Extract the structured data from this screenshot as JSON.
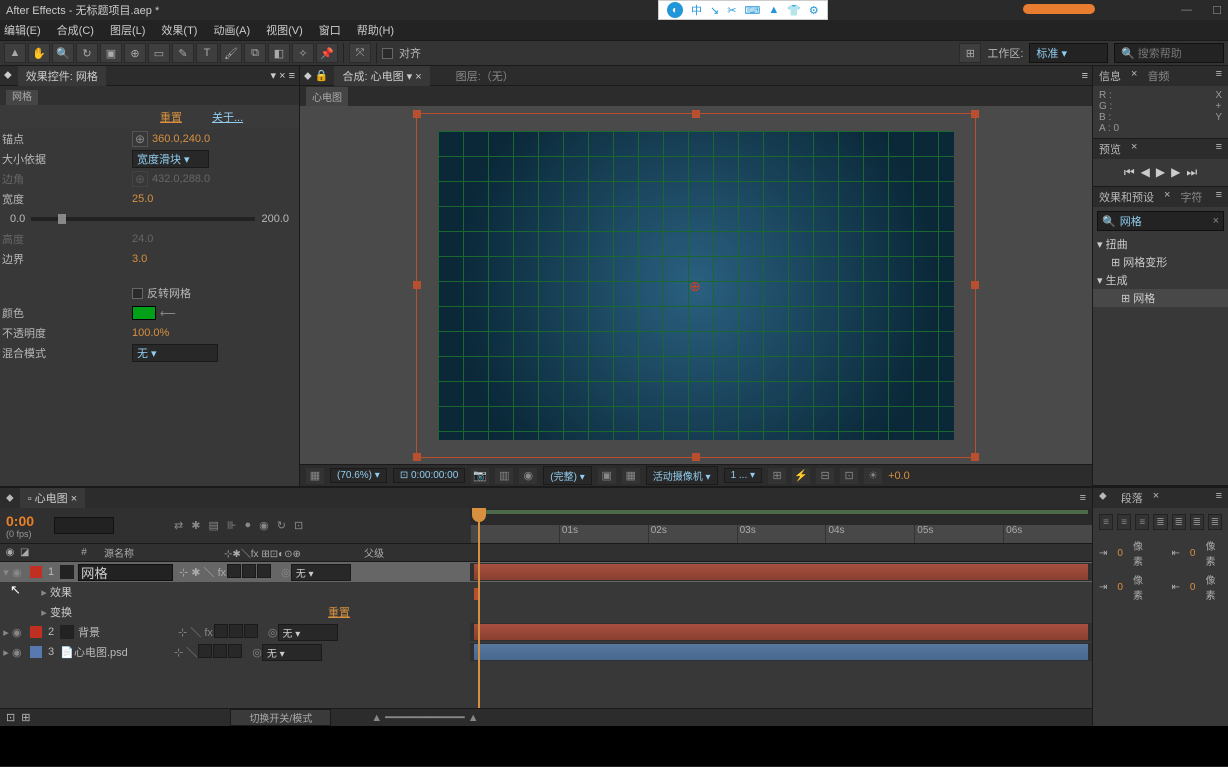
{
  "titlebar": {
    "title": "After Effects - 无标题项目.aep *"
  },
  "menubar": [
    "编辑(E)",
    "合成(C)",
    "图层(L)",
    "效果(T)",
    "动画(A)",
    "视图(V)",
    "窗口",
    "帮助(H)"
  ],
  "toolbar": {
    "align_label": "对齐",
    "workspace_label": "工作区:",
    "workspace_value": "标准",
    "search_placeholder": "搜索帮助"
  },
  "float_toolbar": {
    "items": [
      "中",
      "↘",
      "✂",
      "⌨",
      "▲",
      "👕",
      "⚙"
    ]
  },
  "effects_panel": {
    "tab": "效果控件: 网格",
    "subtab": "网格",
    "reset": "重置",
    "about": "关于...",
    "rows": {
      "anchor": {
        "label": "锚点",
        "value": "360.0,240.0"
      },
      "size_from": {
        "label": "大小依据",
        "value": "宽度滑块"
      },
      "corner": {
        "label": "边角",
        "value": "432.0,288.0"
      },
      "width": {
        "label": "宽度",
        "value": "25.0",
        "slider_min": "0.0",
        "slider_max": "200.0"
      },
      "height": {
        "label": "高度",
        "value": "24.0"
      },
      "border": {
        "label": "边界",
        "value": "3.0"
      },
      "invert": {
        "label": "反转网格"
      },
      "color": {
        "label": "颜色"
      },
      "opacity": {
        "label": "不透明度",
        "value": "100.0%"
      },
      "blend": {
        "label": "混合模式",
        "value": "无"
      }
    }
  },
  "comp_panel": {
    "tab_prefix": "合成:",
    "tab_name": "心电图",
    "layer_label": "图层:（无）",
    "subtab": "心电图"
  },
  "viewer_toolbar": {
    "zoom": "(70.6%)",
    "timecode": "0:00:00:00",
    "full": "(完整)",
    "camera": "活动摄像机",
    "view_count": "1 ...",
    "exposure": "+0.0"
  },
  "info_panel": {
    "tab1": "信息",
    "tab2": "音频",
    "r": "R :",
    "g": "G :",
    "b": "B :",
    "a": "A : 0",
    "x": "X",
    "y": "Y",
    "plus": "+"
  },
  "preview_panel": {
    "tab": "预览"
  },
  "effects_presets_panel": {
    "tab1": "效果和预设",
    "tab2": "字符",
    "search": "网格",
    "groups": {
      "distort": "扭曲",
      "distort_item": "网格变形",
      "generate": "生成",
      "generate_item": "网格"
    }
  },
  "paragraph_panel": {
    "tab": "段落",
    "pixel_label": "像素",
    "zero": "0"
  },
  "timeline": {
    "tab": "心电图",
    "timecode": "0:00",
    "fps": "(0 fps)",
    "ruler": [
      "",
      "01s",
      "02s",
      "03s",
      "04s",
      "05s",
      "06s"
    ],
    "col_num": "#",
    "col_name": "源名称",
    "col_parent": "父级",
    "layers": [
      {
        "num": "1",
        "color": "#c03020",
        "name": "网格",
        "parent": "无"
      },
      {
        "num": "2",
        "color": "#c03020",
        "name": "背景",
        "parent": "无"
      },
      {
        "num": "3",
        "color": "#5878b0",
        "name": "心电图.psd",
        "parent": "无"
      }
    ],
    "sub_effects": "效果",
    "sub_transform": "变换",
    "reset": "重置",
    "toggle_label": "切换开关/模式"
  }
}
